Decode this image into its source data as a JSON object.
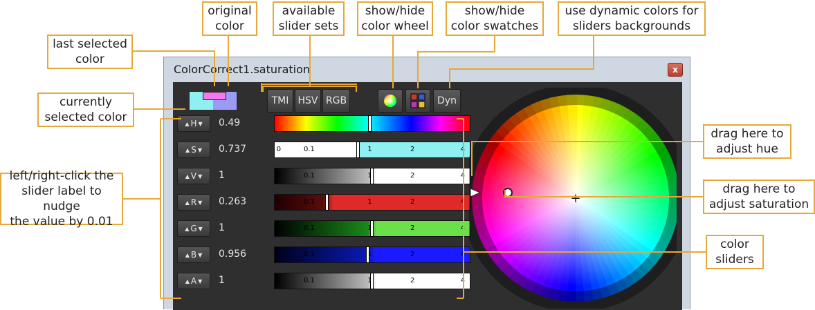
{
  "window": {
    "title": "ColorCorrect1.saturation",
    "close_glyph": "x"
  },
  "callouts": {
    "original_color": "original\ncolor",
    "slider_sets": "available\nslider sets",
    "show_color_wheel": "show/hide\ncolor wheel",
    "show_swatches": "show/hide\ncolor swatches",
    "dynamic_colors": "use dynamic colors for\nsliders backgrounds",
    "last_selected": "last selected\ncolor",
    "currently_selected": "currently\nselected color",
    "nudge": "left/right-click the\nslider label to nudge\nthe value by 0.01",
    "adjust_hue": "drag here to\nadjust hue",
    "adjust_saturation": "drag here to\nadjust saturation",
    "color_sliders": "color\nsliders"
  },
  "toolbar": {
    "tmi": "TMI",
    "hsv": "HSV",
    "rgb": "RGB",
    "dyn": "Dyn",
    "wheel_icon": "color-wheel-icon",
    "swatch_icon": "swatches-icon"
  },
  "swatches": {
    "current_color": "#8ef0f0",
    "original_color": "#9b9bf5",
    "last_color": "#f57af0"
  },
  "sliders": [
    {
      "label": "H",
      "value": "0.49",
      "fraction": 0.49
    },
    {
      "label": "S",
      "value": "0.737",
      "fraction": 0.426
    },
    {
      "label": "V",
      "value": "1",
      "fraction": 0.5
    },
    {
      "label": "R",
      "value": "0.263",
      "fraction": 0.263
    },
    {
      "label": "G",
      "value": "1",
      "fraction": 0.5
    },
    {
      "label": "B",
      "value": "0.956",
      "fraction": 0.478
    },
    {
      "label": "A",
      "value": "1",
      "fraction": 0.5
    }
  ],
  "tick_labels": {
    "zero": "0",
    "point_one": "0.1",
    "one": "1",
    "two": "2",
    "four": "4"
  },
  "wheel": {
    "center_marker": "+"
  }
}
